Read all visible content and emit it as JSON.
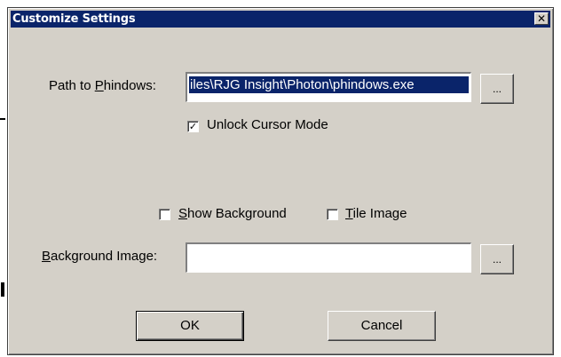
{
  "window": {
    "title": "Customize Settings",
    "close_symbol": "✕"
  },
  "path_row": {
    "label_pre": "Path to ",
    "label_accel": "P",
    "label_post": "hindows:",
    "value": "iles\\RJG Insight\\Photon\\phindows.exe",
    "browse_label": "..."
  },
  "unlock_cursor": {
    "label": "Unlock Cursor Mode",
    "checked": true,
    "check_symbol": "✓"
  },
  "show_background": {
    "label_accel": "S",
    "label_post": "how Background",
    "checked": false
  },
  "tile_image": {
    "label_accel": "T",
    "label_post": "ile Image",
    "checked": false
  },
  "background_row": {
    "label_accel": "B",
    "label_post": "ackground Image:",
    "value": "",
    "browse_label": "..."
  },
  "buttons": {
    "ok": "OK",
    "cancel": "Cancel"
  },
  "icons": {
    "close": "close-icon",
    "check": "checkmark-icon"
  },
  "colors": {
    "dialog_bg": "#d4d0c8",
    "titlebar": "#0a246a",
    "selection": "#0a246a"
  }
}
